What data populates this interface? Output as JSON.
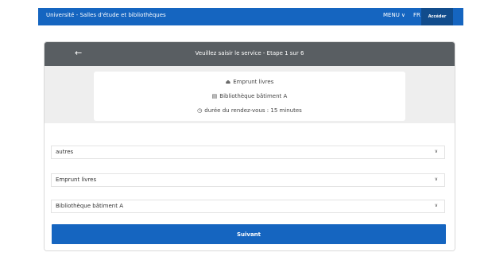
{
  "header": {
    "site_title": "Université - Salles d'étude et bibliothèques",
    "menu_label": "MENU",
    "lang_label": "FR",
    "access_label": "Accéder"
  },
  "step": {
    "title": "Veuillez saisir le service - Etape 1 sur 6"
  },
  "summary": {
    "service": "Emprunt livres",
    "location": "Bibliothèque bâtiment A",
    "duration": "durée du rendez-vous : 15 minutes"
  },
  "form": {
    "category_value": "autres",
    "service_value": "Emprunt livres",
    "location_value": "Bibliothèque bâtiment A",
    "submit_label": "Suivant"
  },
  "colors": {
    "primary": "#1565c0",
    "header_dark": "#595e62",
    "summary_bg": "#eeeeee"
  }
}
